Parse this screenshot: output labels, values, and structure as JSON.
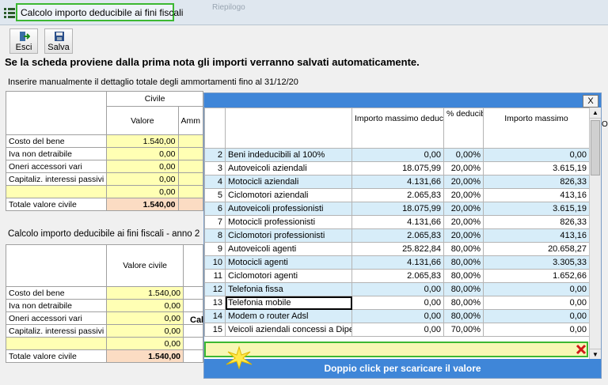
{
  "window": {
    "title": "Calcolo importo deducibile ai fini fiscali",
    "bg_tab": "Riepilogo"
  },
  "toolbar": {
    "exit_label": "Esci",
    "save_label": "Salva"
  },
  "notice": "Se la scheda proviene dalla prima nota gli importi verranno salvati automaticamente.",
  "section1": {
    "title": "Inserire manualmente il dettaglio totale degli ammortamenti fino al 31/12/20",
    "header_group": "Civile",
    "col_valore": "Valore",
    "col_amm": "Amm",
    "rows": [
      {
        "label": "Costo del bene",
        "value": "1.540,00"
      },
      {
        "label": "Iva non detraibile",
        "value": "0,00"
      },
      {
        "label": "Oneri accessori vari",
        "value": "0,00"
      },
      {
        "label": "Capitaliz. interessi passivi",
        "value": "0,00"
      },
      {
        "label": "",
        "value": "0,00"
      }
    ],
    "total_label": "Totale valore civile",
    "total_value": "1.540,00"
  },
  "section2": {
    "title": "Calcolo importo deducibile ai fini fiscali - anno 2",
    "col_valore_civile": "Valore civile",
    "calc_label": "Calc",
    "rows": [
      {
        "label": "Costo del bene",
        "value": "1.540,00"
      },
      {
        "label": "Iva non detraibile",
        "value": "0,00"
      },
      {
        "label": "Oneri accessori vari",
        "value": "0,00"
      },
      {
        "label": "Capitaliz. interessi passivi",
        "value": "0,00"
      },
      {
        "label": "",
        "value": "0,00"
      }
    ],
    "total_label": "Totale valore civile",
    "total_value": "1.540,00"
  },
  "right_letter": "O",
  "popup": {
    "close_label": "X",
    "headers": [
      "",
      "",
      "Importo massimo deducibile",
      "% deducibil e",
      "Importo massimo"
    ],
    "rows": [
      {
        "n": "2",
        "desc": "Beni indeducibili al 100%",
        "imp": "0,00",
        "pct": "0,00%",
        "max": "0,00"
      },
      {
        "n": "3",
        "desc": "Autoveicoli aziendali",
        "imp": "18.075,99",
        "pct": "20,00%",
        "max": "3.615,19"
      },
      {
        "n": "4",
        "desc": "Motocicli aziendali",
        "imp": "4.131,66",
        "pct": "20,00%",
        "max": "826,33"
      },
      {
        "n": "5",
        "desc": "Ciclomotori aziendali",
        "imp": "2.065,83",
        "pct": "20,00%",
        "max": "413,16"
      },
      {
        "n": "6",
        "desc": "Autoveicoli professionisti",
        "imp": "18.075,99",
        "pct": "20,00%",
        "max": "3.615,19"
      },
      {
        "n": "7",
        "desc": "Motocicli professionisti",
        "imp": "4.131,66",
        "pct": "20,00%",
        "max": "826,33"
      },
      {
        "n": "8",
        "desc": "Ciclomotori professionisti",
        "imp": "2.065,83",
        "pct": "20,00%",
        "max": "413,16"
      },
      {
        "n": "9",
        "desc": "Autoveicoli agenti",
        "imp": "25.822,84",
        "pct": "80,00%",
        "max": "20.658,27"
      },
      {
        "n": "10",
        "desc": "Motocicli agenti",
        "imp": "4.131,66",
        "pct": "80,00%",
        "max": "3.305,33"
      },
      {
        "n": "11",
        "desc": "Ciclomotori agenti",
        "imp": "2.065,83",
        "pct": "80,00%",
        "max": "1.652,66"
      },
      {
        "n": "12",
        "desc": "Telefonia fissa",
        "imp": "0,00",
        "pct": "80,00%",
        "max": "0,00"
      },
      {
        "n": "13",
        "desc": "Telefonia mobile",
        "imp": "0,00",
        "pct": "80,00%",
        "max": "0,00"
      },
      {
        "n": "14",
        "desc": "Modem o router Adsl",
        "imp": "0,00",
        "pct": "80,00%",
        "max": "0,00"
      },
      {
        "n": "15",
        "desc": "Veicoli aziendali concessi a Dipen",
        "imp": "0,00",
        "pct": "70,00%",
        "max": "0,00"
      }
    ],
    "selected_row": "13",
    "footer": "Doppio click per scaricare il valore"
  },
  "icons": {
    "app": "app-menu-icon",
    "exit": "exit-icon",
    "save": "floppy-disk-icon",
    "delete": "delete-x-icon"
  },
  "colors": {
    "accent_green": "#3cb832",
    "popup_blue": "#3f86d8",
    "row_blue": "#d7edf9",
    "input_yellow": "#ffffb4",
    "total_peach": "#fbdcc3"
  }
}
